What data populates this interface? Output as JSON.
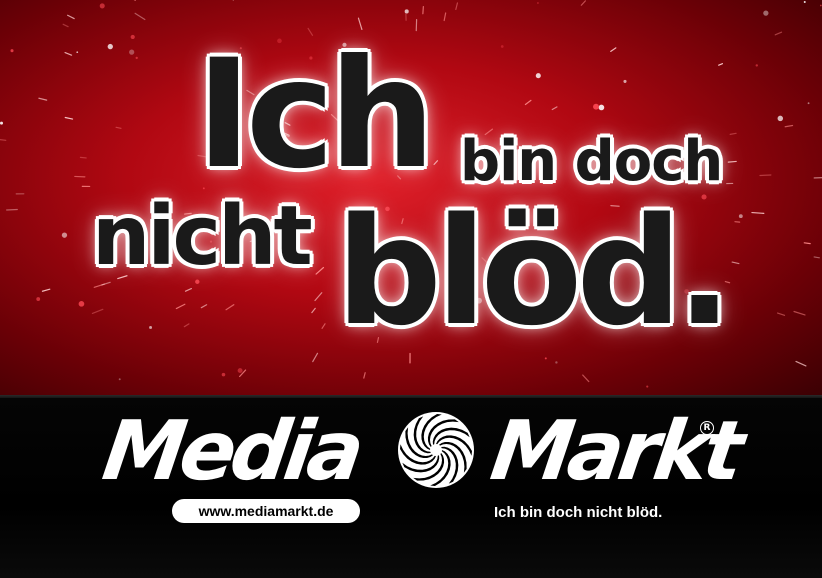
{
  "slogan": {
    "word_ich": "Ich",
    "word_bin_doch": "bin doch",
    "word_nicht": "nicht",
    "word_blod": "blöd."
  },
  "logo": {
    "part_media": "Media",
    "part_markt": "Markt",
    "registered_mark": "R",
    "swirl_icon": "spiral-swirl-icon"
  },
  "footer": {
    "url": "www.mediamarkt.de",
    "tagline": "Ich bin doch nicht blöd."
  },
  "colors": {
    "banner_red": "#d0101c",
    "banner_dark_red": "#6a0006",
    "footer_black": "#000000",
    "text_dark": "#1a1a1a",
    "white": "#ffffff"
  }
}
